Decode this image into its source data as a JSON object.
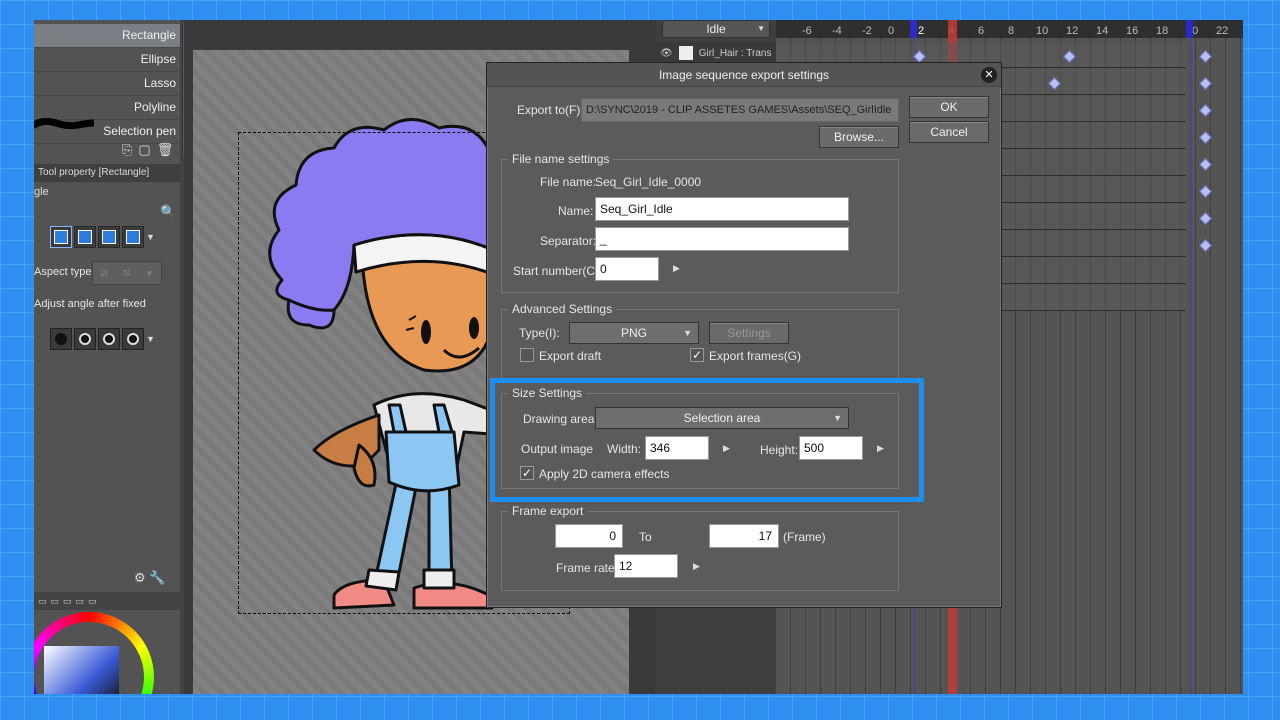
{
  "left_panel": {
    "sub_tools": [
      {
        "label": "Rectangle",
        "active": true
      },
      {
        "label": "Ellipse",
        "active": false
      },
      {
        "label": "Lasso",
        "active": false
      },
      {
        "label": "Polyline",
        "active": false
      },
      {
        "label": "Selection pen",
        "active": false
      }
    ],
    "tool_property_header": "Tool property [Rectangle]",
    "tool_property_name": "gle",
    "aspect_type_label": "Aspect type",
    "adjust_angle_label": "Adjust angle after fixed"
  },
  "timeline": {
    "animation_name": "Idle",
    "layer_name": "Girl_Hair : Trans",
    "ruler_labels": [
      "-6",
      "-4",
      "-2",
      "0",
      "2",
      "4",
      "6",
      "8",
      "10",
      "12",
      "14",
      "16",
      "18",
      "20",
      "22"
    ],
    "current_frame": "2"
  },
  "dialog": {
    "title": "Image sequence export settings",
    "export_to_label": "Export to(F):",
    "export_to_value": "D:\\SYNC\\2019 - CLIP ASSETES GAMES\\Assets\\SEQ_GirlIdle",
    "ok_label": "OK",
    "cancel_label": "Cancel",
    "browse_label": "Browse...",
    "file_name_group": "File name settings",
    "file_name_label": "File name:",
    "file_name_value": "Seq_Girl_Idle_0000",
    "name_label": "Name:",
    "name_value": "Seq_Girl_Idle",
    "separator_label": "Separator:",
    "separator_value": "_",
    "start_number_label": "Start number(C):",
    "start_number_value": "0",
    "advanced_group": "Advanced Settings",
    "type_label": "Type(I):",
    "type_value": "PNG",
    "settings_label": "Settings",
    "export_draft_label": "Export draft",
    "export_draft_checked": false,
    "export_frames_label": "Export frames(G)",
    "export_frames_checked": true,
    "size_group": "Size Settings",
    "drawing_area_label": "Drawing area:",
    "drawing_area_value": "Selection area",
    "output_image_label": "Output image",
    "width_label": "Width:",
    "width_value": "346",
    "height_label": "Height:",
    "height_value": "500",
    "apply_camera_label": "Apply 2D camera effects",
    "apply_camera_checked": true,
    "frame_export_group": "Frame export",
    "frame_from_value": "0",
    "to_label": "To",
    "frame_to_value": "17",
    "frame_unit_label": "(Frame)",
    "frame_rate_label": "Frame rate:",
    "frame_rate_value": "12",
    "checkmark": "✓"
  },
  "colors": {
    "background_blue": "#2f8ff0",
    "highlight_blue": "#1e8ff0",
    "hair_purple": "#8a7cf0",
    "skin": "#e89a55",
    "overalls_blue": "#8cc6f2",
    "shoe_pink": "#f28a86",
    "playhead_red": "#c23a3a",
    "keyframe": "#b8bff5"
  }
}
